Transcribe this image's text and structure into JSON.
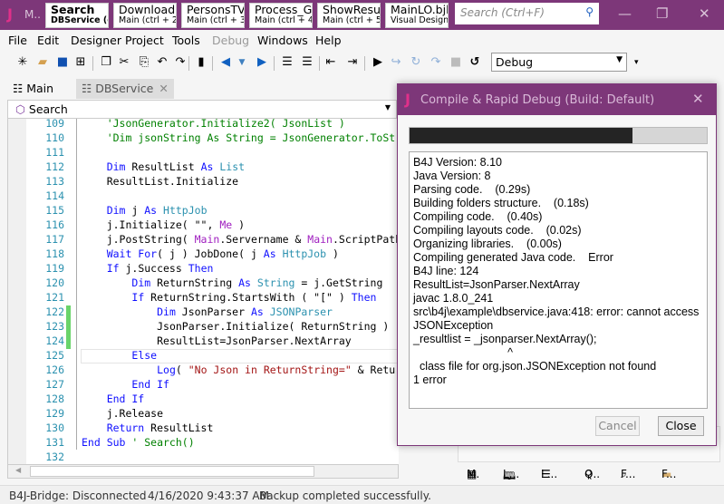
{
  "titlebar": {
    "app_abbrev": "M..",
    "tabs": [
      {
        "title": "Search",
        "sub": "DBService (c"
      },
      {
        "title": "DownloadF",
        "sub": "Main (ctrl + 2"
      },
      {
        "title": "PersonsTV_",
        "sub": "Main (ctrl + 3"
      },
      {
        "title": "Process_Glc",
        "sub": "Main (ctrl + 4"
      },
      {
        "title": "ShowResult",
        "sub": "Main (ctrl + 5"
      },
      {
        "title": "MainLO.bjl",
        "sub": "Visual Designer"
      }
    ],
    "search_placeholder": "Search (Ctrl+F)"
  },
  "menu": [
    "File",
    "Edit",
    "Designer",
    "Project",
    "Tools",
    "Debug",
    "Windows",
    "Help"
  ],
  "toolbar": {
    "build_config": "Debug"
  },
  "module_tabs": [
    {
      "label": "Main"
    },
    {
      "label": "DBService"
    }
  ],
  "sub_selector": "Search",
  "code": [
    {
      "n": "109",
      "i": 1,
      "t": [
        [
          "c",
          "'JsonGenerator.Initialize2( JsonList )"
        ]
      ]
    },
    {
      "n": "110",
      "i": 1,
      "t": [
        [
          "c",
          "'Dim jsonString As String = JsonGenerator.ToString"
        ]
      ]
    },
    {
      "n": "111",
      "i": 0,
      "t": []
    },
    {
      "n": "112",
      "i": 1,
      "t": [
        [
          "k",
          "Dim "
        ],
        [
          "",
          "ResultList "
        ],
        [
          "k",
          "As "
        ],
        [
          "ty",
          "List"
        ]
      ]
    },
    {
      "n": "113",
      "i": 1,
      "t": [
        [
          "",
          "ResultList.Initialize"
        ]
      ]
    },
    {
      "n": "114",
      "i": 0,
      "t": []
    },
    {
      "n": "115",
      "i": 1,
      "t": [
        [
          "k",
          "Dim "
        ],
        [
          "",
          "j "
        ],
        [
          "k",
          "As "
        ],
        [
          "ty",
          "HttpJob"
        ]
      ]
    },
    {
      "n": "116",
      "i": 1,
      "t": [
        [
          "",
          "j.Initialize( \"\", "
        ],
        [
          "m",
          "Me"
        ],
        [
          "",
          " )"
        ]
      ]
    },
    {
      "n": "117",
      "i": 1,
      "t": [
        [
          "",
          "j.PostString( "
        ],
        [
          "m",
          "Main"
        ],
        [
          "",
          ".Servername & "
        ],
        [
          "m",
          "Main"
        ],
        [
          "",
          ".ScriptPath"
        ]
      ]
    },
    {
      "n": "118",
      "i": 1,
      "t": [
        [
          "k",
          "Wait For"
        ],
        [
          "",
          "( j ) JobDone( j "
        ],
        [
          "k",
          "As "
        ],
        [
          "ty",
          "HttpJob"
        ],
        [
          "",
          " )"
        ]
      ]
    },
    {
      "n": "119",
      "i": 1,
      "t": [
        [
          "k",
          "If "
        ],
        [
          "",
          "j.Success "
        ],
        [
          "k",
          "Then"
        ]
      ]
    },
    {
      "n": "120",
      "i": 2,
      "t": [
        [
          "k",
          "Dim "
        ],
        [
          "",
          "ReturnString "
        ],
        [
          "k",
          "As "
        ],
        [
          "ty",
          "String"
        ],
        [
          "",
          " = j.GetString"
        ]
      ]
    },
    {
      "n": "121",
      "i": 2,
      "t": [
        [
          "k",
          "If "
        ],
        [
          "",
          "ReturnString.StartsWith ( \"[\" ) "
        ],
        [
          "k",
          "Then"
        ]
      ]
    },
    {
      "n": "122",
      "i": 3,
      "t": [
        [
          "k",
          "Dim "
        ],
        [
          "",
          "JsonParser "
        ],
        [
          "k",
          "As "
        ],
        [
          "ty",
          "JSONParser"
        ]
      ]
    },
    {
      "n": "123",
      "i": 3,
      "t": [
        [
          "",
          "JsonParser.Initialize( ReturnString )"
        ]
      ]
    },
    {
      "n": "124",
      "i": 3,
      "t": [
        [
          "",
          "ResultList=JsonParser.NextArray"
        ]
      ]
    },
    {
      "n": "125",
      "i": 2,
      "t": [
        [
          "k",
          "Else"
        ]
      ]
    },
    {
      "n": "126",
      "i": 3,
      "t": [
        [
          "k",
          "Log"
        ],
        [
          "",
          "( "
        ],
        [
          "s",
          "\"No Json in ReturnString=\""
        ],
        [
          "",
          " & ReturnString"
        ]
      ]
    },
    {
      "n": "127",
      "i": 2,
      "t": [
        [
          "k",
          "End If"
        ]
      ]
    },
    {
      "n": "128",
      "i": 1,
      "t": [
        [
          "k",
          "End If"
        ]
      ]
    },
    {
      "n": "129",
      "i": 1,
      "t": [
        [
          "",
          "j.Release"
        ]
      ]
    },
    {
      "n": "130",
      "i": 1,
      "t": [
        [
          "k",
          "Return "
        ],
        [
          "",
          "ResultList"
        ]
      ]
    },
    {
      "n": "131",
      "i": 0,
      "t": [
        [
          "k",
          "End Sub "
        ],
        [
          "c",
          "' Search()"
        ]
      ]
    },
    {
      "n": "132",
      "i": 0,
      "t": []
    }
  ],
  "changed_lines": [
    "122",
    "123",
    "124"
  ],
  "status": {
    "bridge": "B4J-Bridge: Disconnected",
    "time": "4/16/2020 9:43:37 AM",
    "message": "Backup completed successfully."
  },
  "dialog": {
    "title": "Compile & Rapid Debug (Build: Default)",
    "progress_percent": 75,
    "log": [
      "B4J Version: 8.10",
      "Java Version: 8",
      "Parsing code.    (0.29s)",
      "Building folders structure.    (0.18s)",
      "Compiling code.    (0.40s)",
      "Compiling layouts code.    (0.02s)",
      "Organizing libraries.    (0.00s)",
      "Compiling generated Java code.    Error",
      "B4J line: 124",
      "ResultList=JsonParser.NextArray",
      "javac 1.8.0_241",
      "src\\b4j\\example\\dbservice.java:418: error: cannot access",
      "JSONException",
      "_resultlist = _jsonparser.NextArray();",
      "                              ^",
      "  class file for org.json.JSONException not found",
      "1 error"
    ],
    "cancel": "Cancel",
    "close": "Close"
  },
  "right_tabs": [
    "M.",
    "L...",
    "L...",
    "Q..",
    "F...",
    "F..."
  ]
}
